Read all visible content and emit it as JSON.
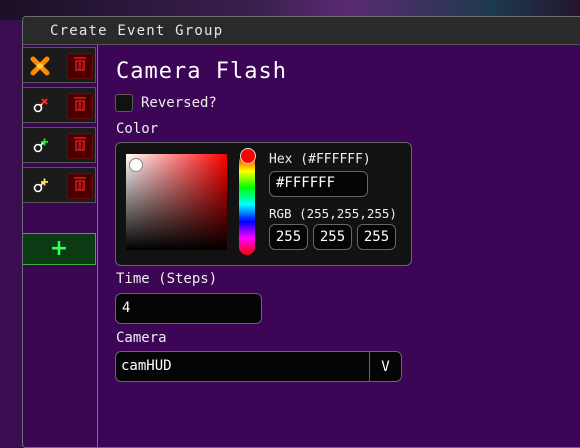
{
  "window": {
    "title": "Create Event Group"
  },
  "sidebar": {
    "events": [
      {
        "icon": "orange-x-icon",
        "delete_icon": "trash-icon"
      },
      {
        "icon": "camera-remove-icon",
        "delete_icon": "trash-icon"
      },
      {
        "icon": "camera-add-icon",
        "delete_icon": "trash-icon"
      },
      {
        "icon": "camera-flash-icon",
        "delete_icon": "trash-icon"
      }
    ],
    "add_label": "+"
  },
  "main": {
    "title": "Camera Flash",
    "reversed_label": "Reversed?",
    "reversed_checked": false,
    "color_label": "Color",
    "color_picker": {
      "hex_label": "Hex (#FFFFFF)",
      "hex_value": "#FFFFFF",
      "rgb_label": "RGB (255,255,255)",
      "r": "255",
      "g": "255",
      "b": "255",
      "hue_color": "#ff0000"
    },
    "time_label": "Time (Steps)",
    "time_value": "4",
    "camera_label": "Camera",
    "camera_value": "camHUD",
    "camera_dropdown_glyph": "V"
  },
  "colors": {
    "background": "#3c0556",
    "add_button_border": "#3fae3f"
  }
}
